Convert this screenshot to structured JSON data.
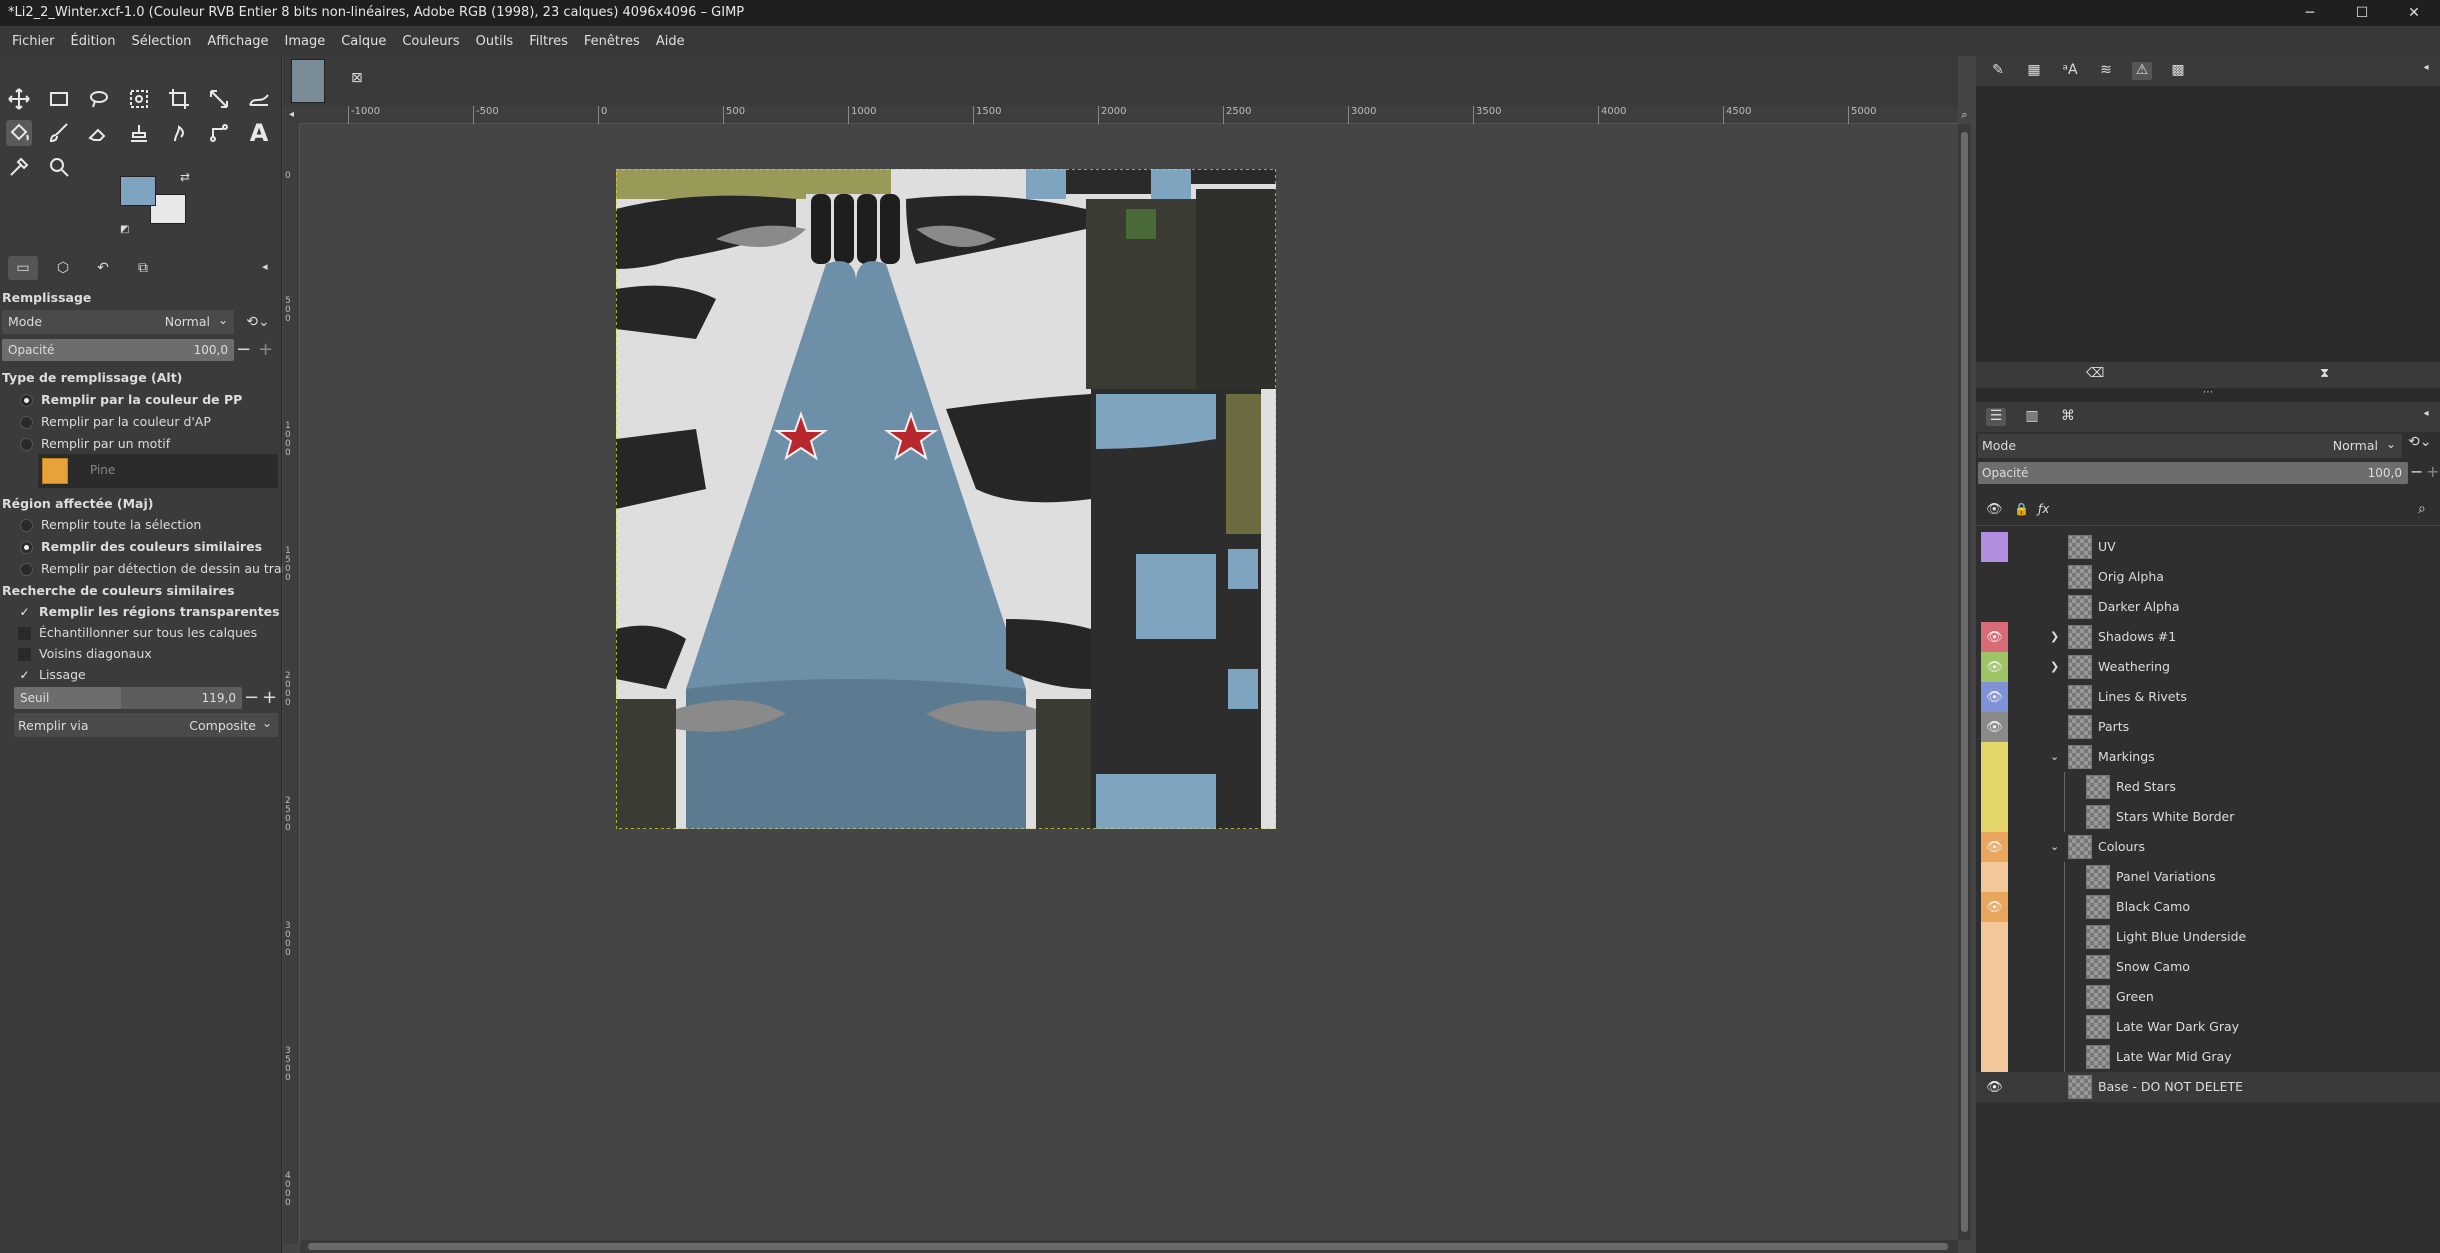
{
  "window": {
    "title": "*Li2_2_Winter.xcf-1.0 (Couleur RVB Entier 8 bits non-linéaires, Adobe RGB (1998), 23 calques) 4096x4096 – GIMP",
    "controls": [
      "─",
      "☐",
      "✕"
    ]
  },
  "menu": [
    "Fichier",
    "Édition",
    "Sélection",
    "Affichage",
    "Image",
    "Calque",
    "Couleurs",
    "Outils",
    "Filtres",
    "Fenêtres",
    "Aide"
  ],
  "tool_options": {
    "title": "Remplissage",
    "mode_label": "Mode",
    "mode_value": "Normal",
    "opacity_label": "Opacité",
    "opacity_value": "100,0",
    "fill_type_label": "Type de remplissage  (Alt)",
    "fill_types": [
      "Remplir par la couleur de PP",
      "Remplir par la couleur d'AP",
      "Remplir par un motif"
    ],
    "pattern_name": "Pine",
    "region_label": "Région affectée  (Maj)",
    "regions": [
      "Remplir toute la sélection",
      "Remplir des couleurs similaires",
      "Remplir par détection de dessin au trait"
    ],
    "similar_label": "Recherche de couleurs similaires",
    "checks": [
      {
        "label": "Remplir les régions transparentes",
        "on": true
      },
      {
        "label": "Échantillonner sur tous les calques",
        "on": false
      },
      {
        "label": "Voisins diagonaux",
        "on": false
      },
      {
        "label": "Lissage",
        "on": true
      }
    ],
    "threshold_label": "Seuil",
    "threshold_value": "119,0",
    "fill_by_label": "Remplir via",
    "fill_by_value": "Composite"
  },
  "ruler_h": [
    "-1000",
    "-500",
    "0",
    "500",
    "1000",
    "1500",
    "2000",
    "2500",
    "3000",
    "3500",
    "4000",
    "4500",
    "5000"
  ],
  "ruler_v": [
    "0",
    "500",
    "1000",
    "1500",
    "2000",
    "2500",
    "3000",
    "3500",
    "4000"
  ],
  "layers_panel": {
    "mode_label": "Mode",
    "mode_value": "Normal",
    "opacity_label": "Opacité",
    "opacity_value": "100,0",
    "layers": [
      {
        "name": "UV",
        "indent": 0,
        "eye": false,
        "tag": "#b08ee0",
        "arrow": ""
      },
      {
        "name": "Orig Alpha",
        "indent": 0,
        "eye": false,
        "tag": "",
        "arrow": ""
      },
      {
        "name": "Darker Alpha",
        "indent": 0,
        "eye": false,
        "tag": "",
        "arrow": ""
      },
      {
        "name": "Shadows #1",
        "indent": 0,
        "eye": true,
        "tag": "#d96b77",
        "arrow": "›"
      },
      {
        "name": "Weathering",
        "indent": 0,
        "eye": true,
        "tag": "#9fc466",
        "arrow": "›"
      },
      {
        "name": "Lines & Rivets",
        "indent": 0,
        "eye": true,
        "tag": "#7f92d6",
        "arrow": ""
      },
      {
        "name": "Parts",
        "indent": 0,
        "eye": true,
        "tag": "#8a8a8a",
        "arrow": ""
      },
      {
        "name": "Markings",
        "indent": 0,
        "eye": false,
        "tag": "#e5d66a",
        "arrow": "⌄"
      },
      {
        "name": "Red Stars",
        "indent": 1,
        "eye": false,
        "tag": "#e5d66a",
        "arrow": ""
      },
      {
        "name": "Stars White Border",
        "indent": 1,
        "eye": false,
        "tag": "#e5d66a",
        "arrow": ""
      },
      {
        "name": "Colours",
        "indent": 0,
        "eye": true,
        "tag": "#eba65e",
        "arrow": "⌄"
      },
      {
        "name": "Panel Variations",
        "indent": 1,
        "eye": false,
        "tag": "#f2c79a",
        "arrow": ""
      },
      {
        "name": "Black Camo",
        "indent": 1,
        "eye": true,
        "tag": "#eba65e",
        "arrow": ""
      },
      {
        "name": "Light Blue Underside",
        "indent": 1,
        "eye": false,
        "tag": "#f2c79a",
        "arrow": ""
      },
      {
        "name": "Snow Camo",
        "indent": 1,
        "eye": false,
        "tag": "#f2c79a",
        "arrow": ""
      },
      {
        "name": "Green",
        "indent": 1,
        "eye": false,
        "tag": "#f2c79a",
        "arrow": ""
      },
      {
        "name": "Late War Dark Gray",
        "indent": 1,
        "eye": false,
        "tag": "#f2c79a",
        "arrow": ""
      },
      {
        "name": "Late War Mid Gray",
        "indent": 1,
        "eye": false,
        "tag": "#f2c79a",
        "arrow": ""
      },
      {
        "name": "Base - DO NOT DELETE",
        "indent": 0,
        "eye": true,
        "tag": "",
        "arrow": ""
      }
    ]
  },
  "colors": {
    "fg": "#7fa4bf",
    "bg": "#e8e8e8",
    "canvas_bg": "#454545",
    "pattern": "#e8a23a"
  }
}
